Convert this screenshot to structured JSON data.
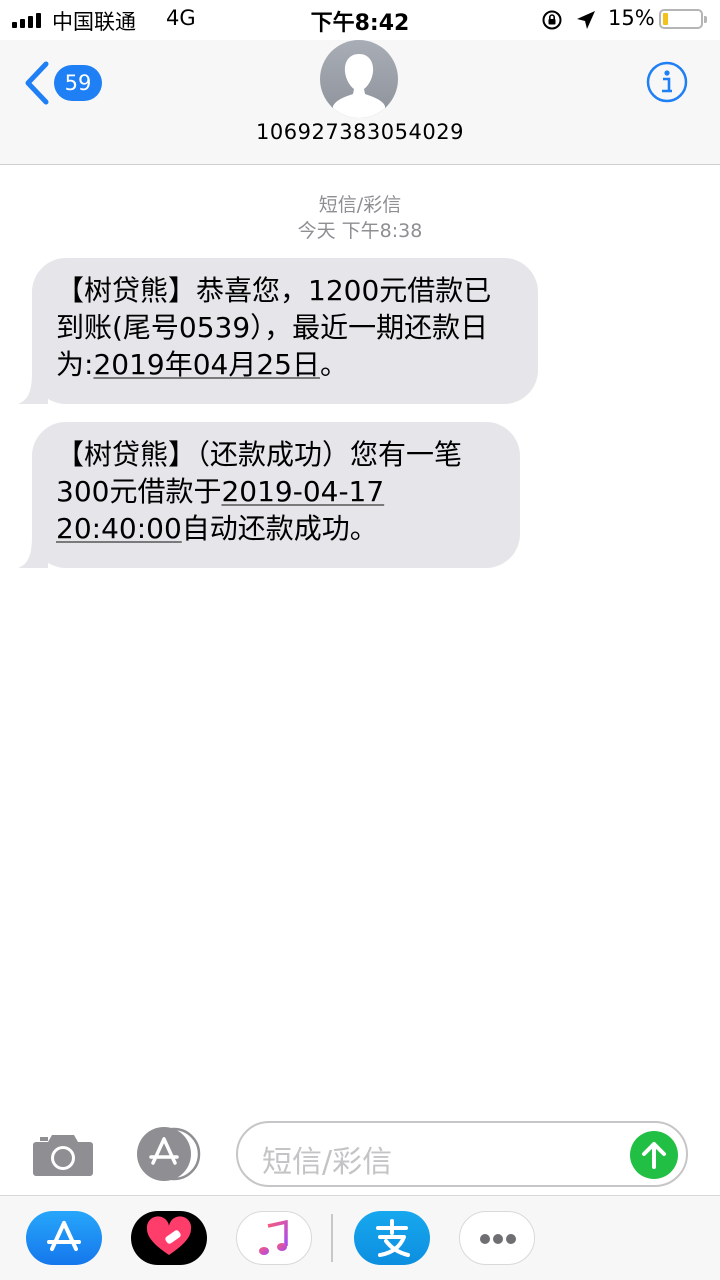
{
  "status_bar": {
    "carrier": "中国联通",
    "network": "4G",
    "time": "下午8:42",
    "battery_percent": "15%",
    "battery_level": 0.15,
    "battery_color": "#f4c21a"
  },
  "nav": {
    "back_badge": "59",
    "contact_number": "106927383054029",
    "accent_color": "#1f7ff5"
  },
  "thread": {
    "service_label": "短信/彩信",
    "timestamp": "今天 下午8:38",
    "messages": [
      {
        "part1": "【树贷熊】恭喜您，1200元借款已到账(尾号0539），最近一期还款日为:",
        "link": "2019年04月25日",
        "part2": "。"
      },
      {
        "part1": "【树贷熊】（还款成功）您有一笔300元借款于",
        "link": "2019-04-17 20:40:00",
        "part2": "自动还款成功。"
      }
    ]
  },
  "input_bar": {
    "placeholder": "短信/彩信",
    "send_color": "#21c044"
  },
  "icons": [
    "camera-icon",
    "app-store-icon",
    "send-arrow-icon",
    "back-chevron-icon",
    "info-icon",
    "contact-avatar-icon"
  ],
  "drawer": {
    "apps": [
      "app-store",
      "health-donation",
      "music",
      "alipay",
      "more"
    ]
  }
}
